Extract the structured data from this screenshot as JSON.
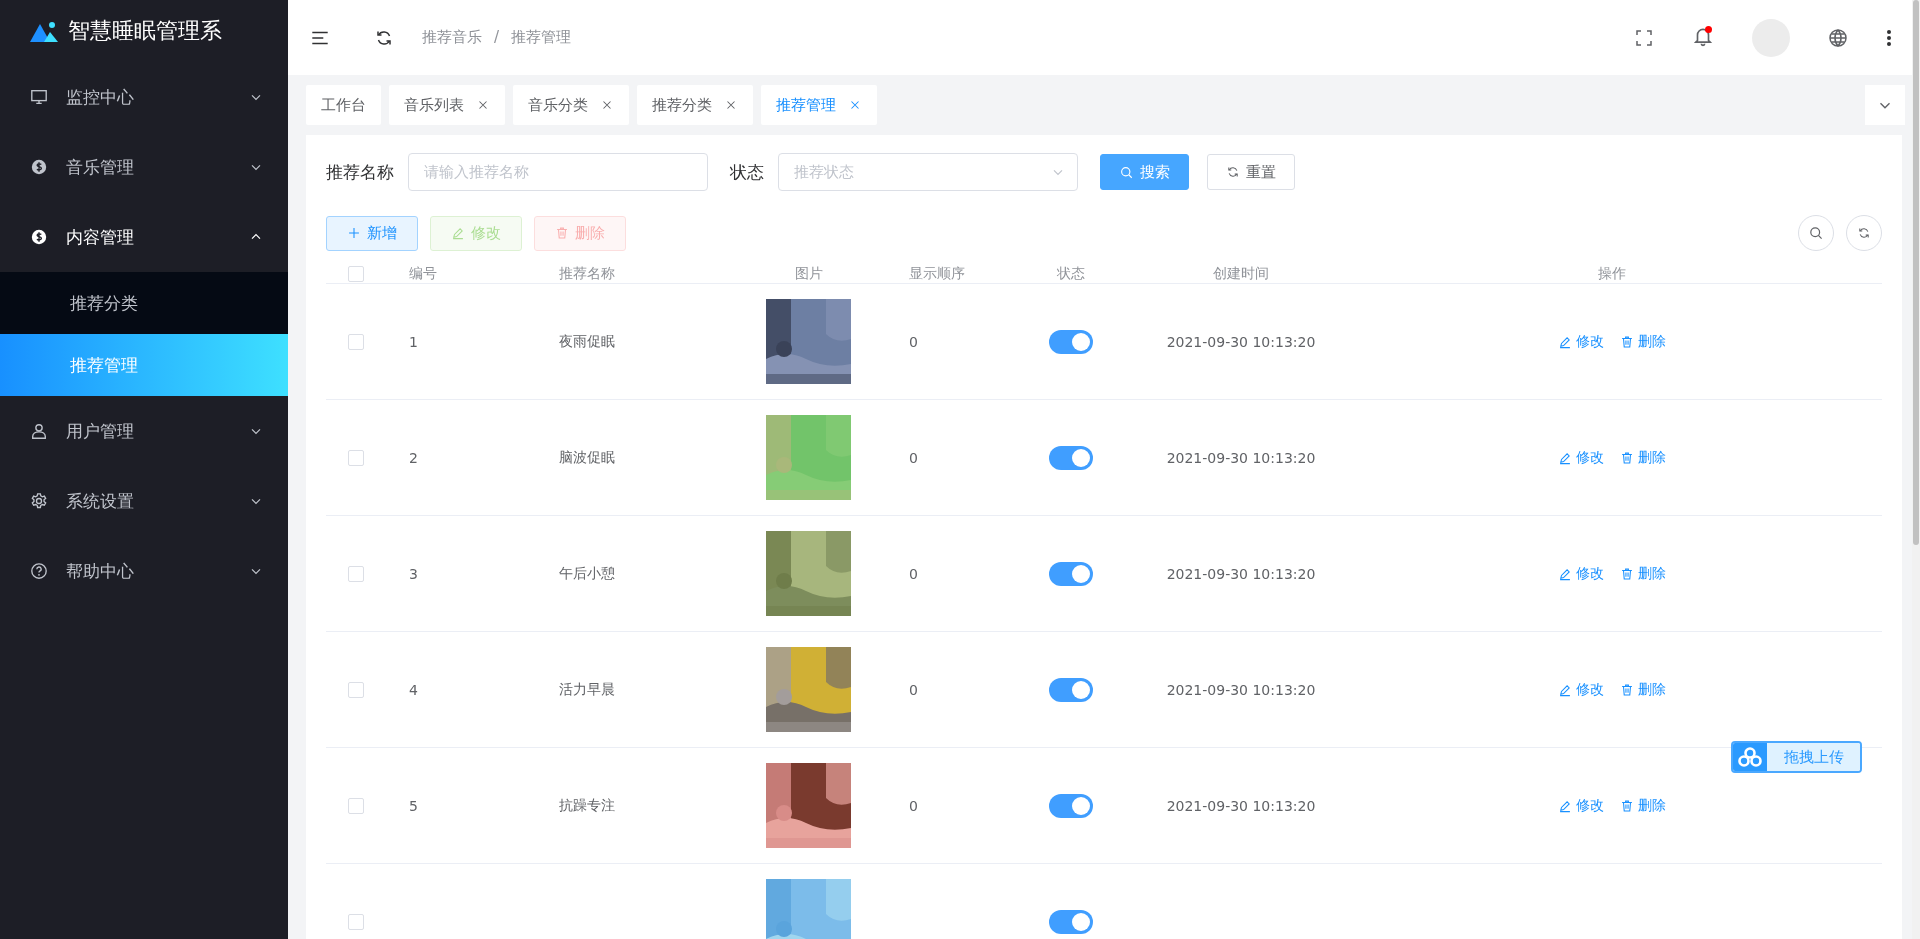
{
  "sidebar": {
    "title": "智慧睡眠管理系",
    "items": [
      {
        "label": "监控中心",
        "expanded": false
      },
      {
        "label": "音乐管理",
        "expanded": false
      },
      {
        "label": "内容管理",
        "expanded": true,
        "children": [
          {
            "label": "推荐分类",
            "selected": false
          },
          {
            "label": "推荐管理",
            "selected": true
          }
        ]
      },
      {
        "label": "用户管理",
        "expanded": false
      },
      {
        "label": "系统设置",
        "expanded": false
      },
      {
        "label": "帮助中心",
        "expanded": false
      }
    ]
  },
  "header": {
    "breadcrumb": [
      "推荐音乐",
      "推荐管理"
    ],
    "separator": "/",
    "notifications_unread": true
  },
  "tabs": [
    {
      "label": "工作台",
      "closable": false,
      "selected": false
    },
    {
      "label": "音乐列表",
      "closable": true,
      "selected": false
    },
    {
      "label": "音乐分类",
      "closable": true,
      "selected": false
    },
    {
      "label": "推荐分类",
      "closable": true,
      "selected": false
    },
    {
      "label": "推荐管理",
      "closable": true,
      "selected": true
    }
  ],
  "search": {
    "fields": [
      {
        "label": "推荐名称",
        "placeholder": "请输入推荐名称",
        "kind": "input"
      },
      {
        "label": "状态",
        "placeholder": "推荐状态",
        "kind": "select"
      }
    ],
    "search_button": "搜索",
    "reset_button": "重置"
  },
  "toolbar": [
    {
      "label": "新增",
      "kind": "add",
      "disabled": false
    },
    {
      "label": "修改",
      "kind": "edit",
      "disabled": true
    },
    {
      "label": "删除",
      "kind": "delete",
      "disabled": true
    }
  ],
  "table": {
    "all_checked": false,
    "columns": [
      "编号",
      "推荐名称",
      "图片",
      "显示顺序",
      "状态",
      "创建时间",
      "操作"
    ],
    "rows": [
      {
        "checked": false,
        "id": "1",
        "name": "夜雨促眠",
        "image": {
          "kind": "picture"
        },
        "order": "0",
        "enabled": true,
        "created": "2021-09-30 10:13:20",
        "actions": [
          "修改",
          "删除"
        ]
      },
      {
        "checked": false,
        "id": "2",
        "name": "脑波促眠",
        "image": {
          "kind": "picture"
        },
        "order": "0",
        "enabled": true,
        "created": "2021-09-30 10:13:20",
        "actions": [
          "修改",
          "删除"
        ]
      },
      {
        "checked": false,
        "id": "3",
        "name": "午后小憩",
        "image": {
          "kind": "picture"
        },
        "order": "0",
        "enabled": true,
        "created": "2021-09-30 10:13:20",
        "actions": [
          "修改",
          "删除"
        ]
      },
      {
        "checked": false,
        "id": "4",
        "name": "活力早晨",
        "image": {
          "kind": "picture"
        },
        "order": "0",
        "enabled": true,
        "created": "2021-09-30 10:13:20",
        "actions": [
          "修改",
          "删除"
        ]
      },
      {
        "checked": false,
        "id": "5",
        "name": "抗躁专注",
        "image": {
          "kind": "picture"
        },
        "order": "0",
        "enabled": true,
        "created": "2021-09-30 10:13:20",
        "actions": [
          "修改",
          "删除"
        ]
      },
      {
        "checked": false,
        "image": {
          "kind": "picture"
        },
        "enabled": true
      }
    ]
  },
  "upload_widget": {
    "label": "拖拽上传"
  }
}
